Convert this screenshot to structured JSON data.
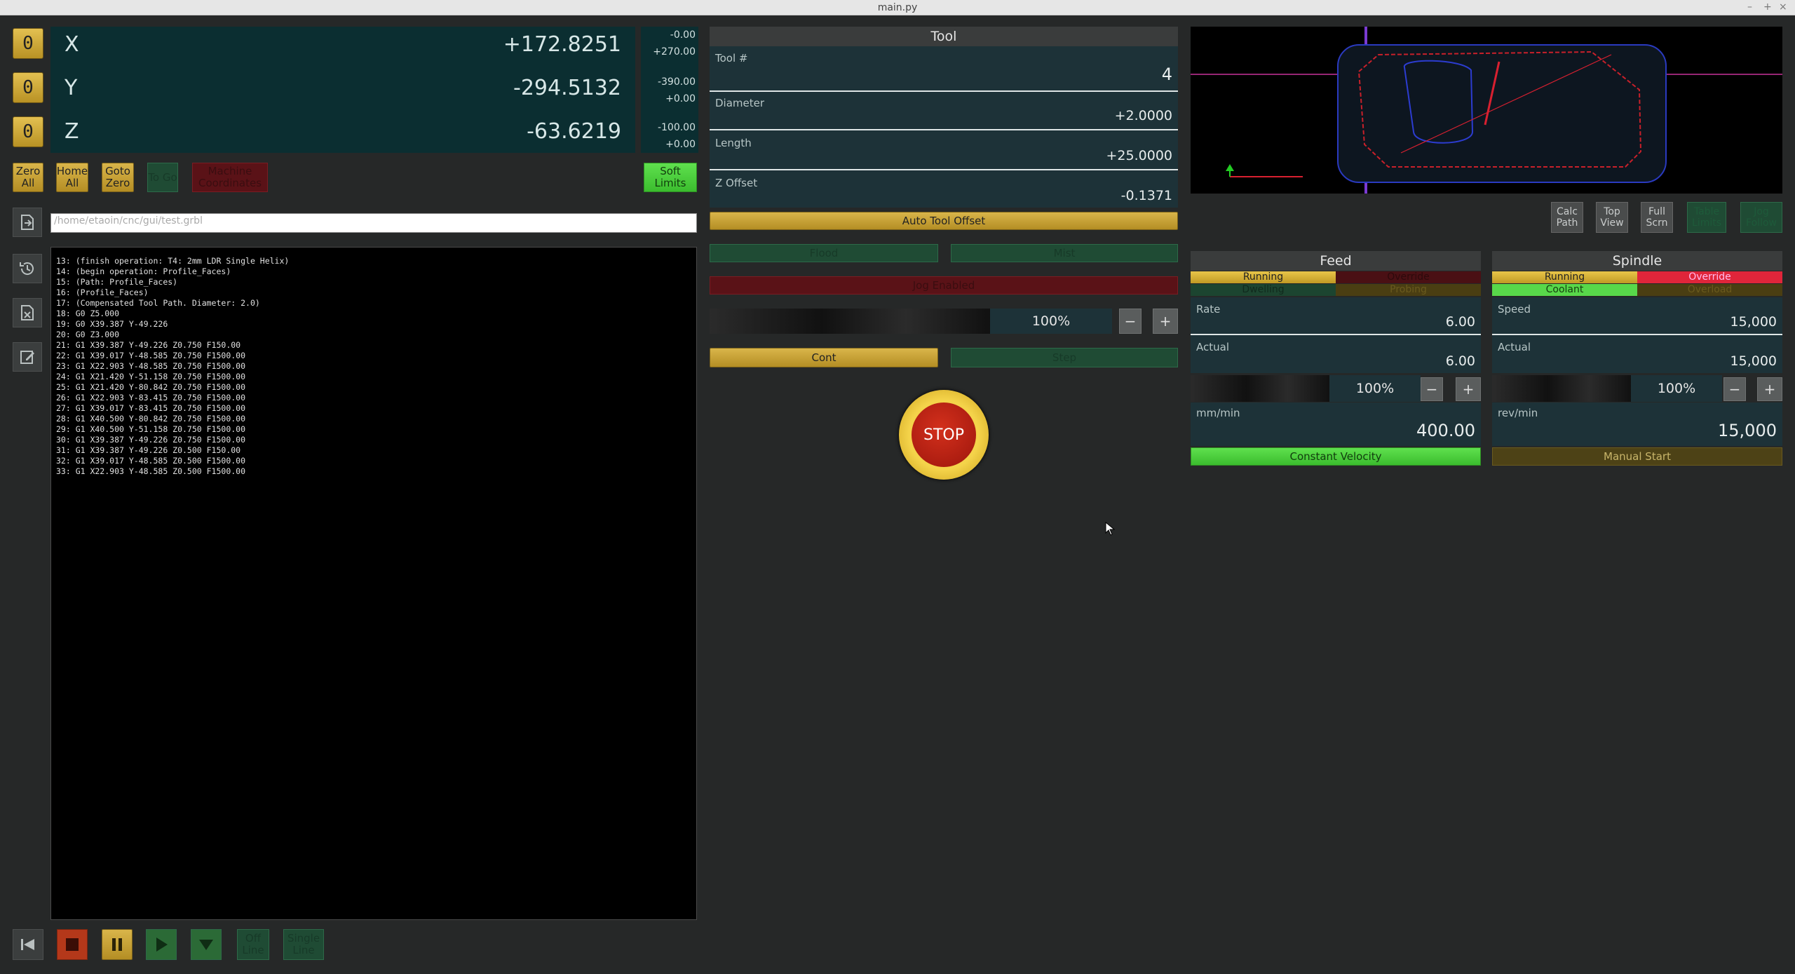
{
  "window": {
    "title": "main.py",
    "controls": [
      "–",
      "+",
      "×"
    ]
  },
  "dro": {
    "zero_label": "0",
    "axes": [
      {
        "name": "X",
        "value": "+172.8251",
        "limit_min": "-0.00",
        "limit_max": "+270.00"
      },
      {
        "name": "Y",
        "value": "-294.5132",
        "limit_min": "-390.00",
        "limit_max": "+0.00"
      },
      {
        "name": "Z",
        "value": "-63.6219",
        "limit_min": "-100.00",
        "limit_max": "+0.00"
      }
    ]
  },
  "buttons": {
    "zero_all": "Zero All",
    "home_all": "Home All",
    "goto_zero": "Goto Zero",
    "to_go": "To Go",
    "machine_coords": "Machine Coordinates",
    "soft_limits": "Soft Limits"
  },
  "file": {
    "path": "/home/etaoin/cnc/gui/test.grbl"
  },
  "gcode_lines": [
    "13: (finish operation: T4: 2mm LDR Single Helix)",
    "14: (begin operation: Profile_Faces)",
    "15: (Path: Profile_Faces)",
    "16: (Profile_Faces)",
    "17: (Compensated Tool Path. Diameter: 2.0)",
    "18: G0 Z5.000",
    "19: G0 X39.387 Y-49.226",
    "20: G0 Z3.000",
    "21: G1 X39.387 Y-49.226 Z0.750 F150.00",
    "22: G1 X39.017 Y-48.585 Z0.750 F1500.00",
    "23: G1 X22.903 Y-48.585 Z0.750 F1500.00",
    "24: G1 X21.420 Y-51.158 Z0.750 F1500.00",
    "25: G1 X21.420 Y-80.842 Z0.750 F1500.00",
    "26: G1 X22.903 Y-83.415 Z0.750 F1500.00",
    "27: G1 X39.017 Y-83.415 Z0.750 F1500.00",
    "28: G1 X40.500 Y-80.842 Z0.750 F1500.00",
    "29: G1 X40.500 Y-51.158 Z0.750 F1500.00",
    "30: G1 X39.387 Y-49.226 Z0.750 F1500.00",
    "31: G1 X39.387 Y-49.226 Z0.500 F150.00",
    "32: G1 X39.017 Y-48.585 Z0.500 F1500.00",
    "33: G1 X22.903 Y-48.585 Z0.500 F1500.00"
  ],
  "transport": {
    "offline": "Off Line",
    "single_line": "Single Line"
  },
  "tool": {
    "title": "Tool",
    "number_label": "Tool #",
    "number": "4",
    "diameter_label": "Diameter",
    "diameter": "+2.0000",
    "length_label": "Length",
    "length": "+25.0000",
    "zoffset_label": "Z Offset",
    "zoffset": "-0.1371",
    "auto_offset": "Auto Tool Offset",
    "flood": "Flood",
    "mist": "Mist",
    "jog_enabled": "Jog Enabled",
    "jog_percent": "100%",
    "cont": "Cont",
    "step": "Step",
    "stop": "STOP",
    "minus": "−",
    "plus": "+"
  },
  "view_buttons": [
    {
      "label": "Calc Path"
    },
    {
      "label": "Top View"
    },
    {
      "label": "Full Scrn"
    },
    {
      "label": "Table Limits"
    },
    {
      "label": "Jog Follow"
    }
  ],
  "feed": {
    "title": "Feed",
    "running": "Running",
    "override": "Override",
    "dwelling": "Dwelling",
    "probing": "Probing",
    "rate_label": "Rate",
    "rate": "6.00",
    "actual_label": "Actual",
    "actual": "6.00",
    "override_percent": "100%",
    "unit": "mm/min",
    "setpoint": "400.00",
    "mode": "Constant Velocity"
  },
  "spindle": {
    "title": "Spindle",
    "running": "Running",
    "override": "Override",
    "coolant": "Coolant",
    "overload": "Overload",
    "speed_label": "Speed",
    "speed": "15,000",
    "actual_label": "Actual",
    "actual": "15,000",
    "override_percent": "100%",
    "unit": "rev/min",
    "setpoint": "15,000",
    "mode": "Manual Start"
  }
}
